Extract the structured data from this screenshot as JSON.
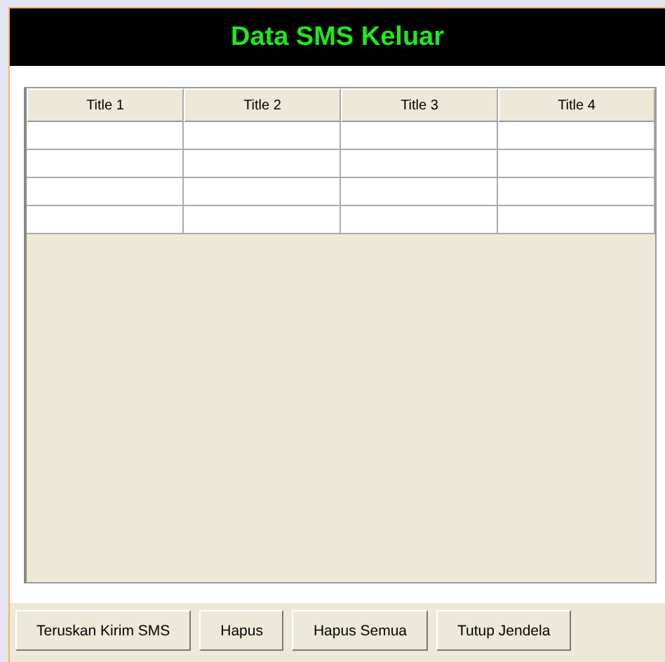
{
  "header": {
    "title": "Data SMS Keluar"
  },
  "table": {
    "columns": [
      "Title 1",
      "Title 2",
      "Title 3",
      "Title 4"
    ]
  },
  "buttons": [
    "Teruskan Kirim SMS",
    "Hapus",
    "Hapus Semua",
    "Tutup Jendela"
  ]
}
